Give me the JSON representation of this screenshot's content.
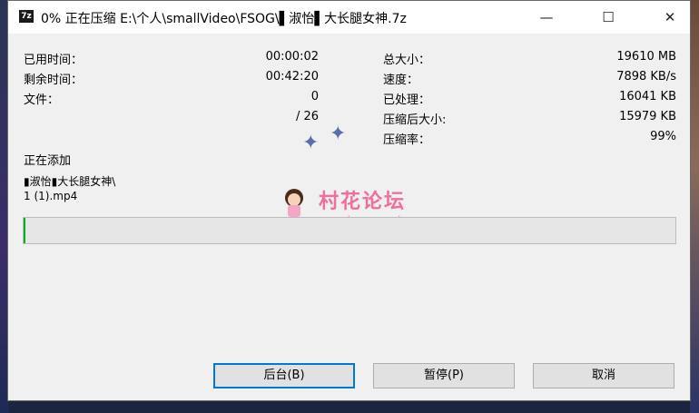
{
  "window": {
    "title": "0% 正在压缩 E:\\个人\\smallVideo\\FSOG\\▌淑怡▌大长腿女神.7z",
    "app_icon_text": "7z",
    "controls": {
      "minimize": "—",
      "maximize": "☐",
      "close": "✕"
    }
  },
  "stats_left": [
    {
      "label": "已用时间：",
      "value": "00:00:02"
    },
    {
      "label": "剩余时间：",
      "value": "00:42:20"
    },
    {
      "label": "文件：",
      "value": "0"
    },
    {
      "label": "",
      "value": "/ 26"
    }
  ],
  "stats_right": [
    {
      "label": "总大小：",
      "value": "19610 MB"
    },
    {
      "label": "速度：",
      "value": "7898 KB/s"
    },
    {
      "label": "已处理：",
      "value": "16041 KB"
    },
    {
      "label": "压缩后大小:",
      "value": "15979 KB"
    },
    {
      "label": "压缩率：",
      "value": "99%"
    }
  ],
  "current": {
    "label": "正在添加",
    "file_line1": "▮淑怡▮大长腿女神\\",
    "file_line2": "1 (1).mp4"
  },
  "progress": {
    "percent": 0.3,
    "fill_color": "#06b025"
  },
  "buttons": {
    "background": "后台(B)",
    "pause": "暂停(P)",
    "cancel": "取消"
  },
  "watermark": {
    "cn": "村花论坛",
    "en": "cunhua.win"
  },
  "icons": [
    "sparkle-icon",
    "mascot-icon"
  ]
}
